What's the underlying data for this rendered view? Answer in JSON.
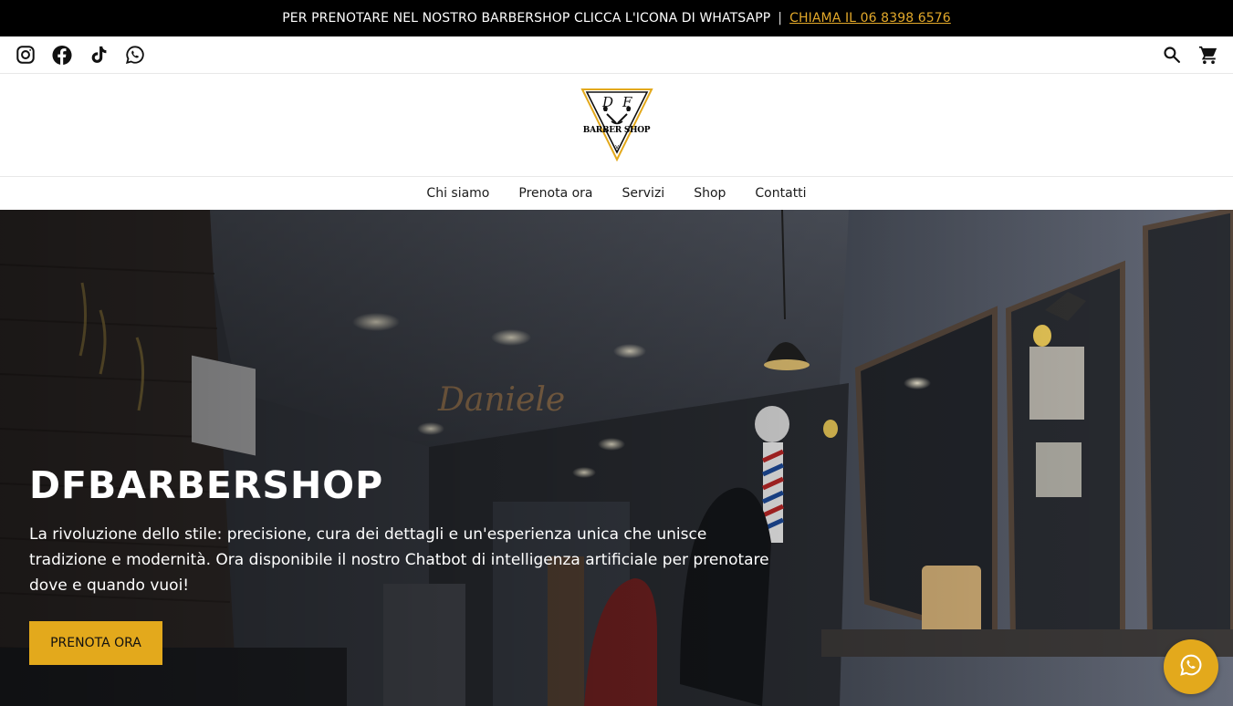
{
  "announcement": {
    "text": "PER PRENOTARE NEL NOSTRO BARBERSHOP CLICCA L'ICONA DI WHATSAPP",
    "separator": "|",
    "call_link": "CHIAMA IL 06 8398 6576",
    "link_color": "#e3a92a"
  },
  "social_icons": [
    "instagram-icon",
    "facebook-icon",
    "tiktok-icon",
    "whatsapp-icon"
  ],
  "tool_icons": [
    "search-icon",
    "cart-icon"
  ],
  "logo": {
    "monogram": "D F",
    "text": "BARBER SHOP",
    "accent_color": "#e3a91c"
  },
  "nav": {
    "items": [
      "Chi siamo",
      "Prenota ora",
      "Servizi",
      "Shop",
      "Contatti"
    ]
  },
  "hero": {
    "title": "DFBARBERSHOP",
    "text": "La rivoluzione dello stile: precisione, cura dei dettagli e un'esperienza unica che unisce tradizione e modernità. Ora disponibile il nostro Chatbot di intelligenza artificiale per prenotare dove e quando vuoi!",
    "button": "PRENOTA ORA",
    "button_color": "#e3a91c"
  },
  "floating_button": {
    "icon": "whatsapp-icon"
  }
}
